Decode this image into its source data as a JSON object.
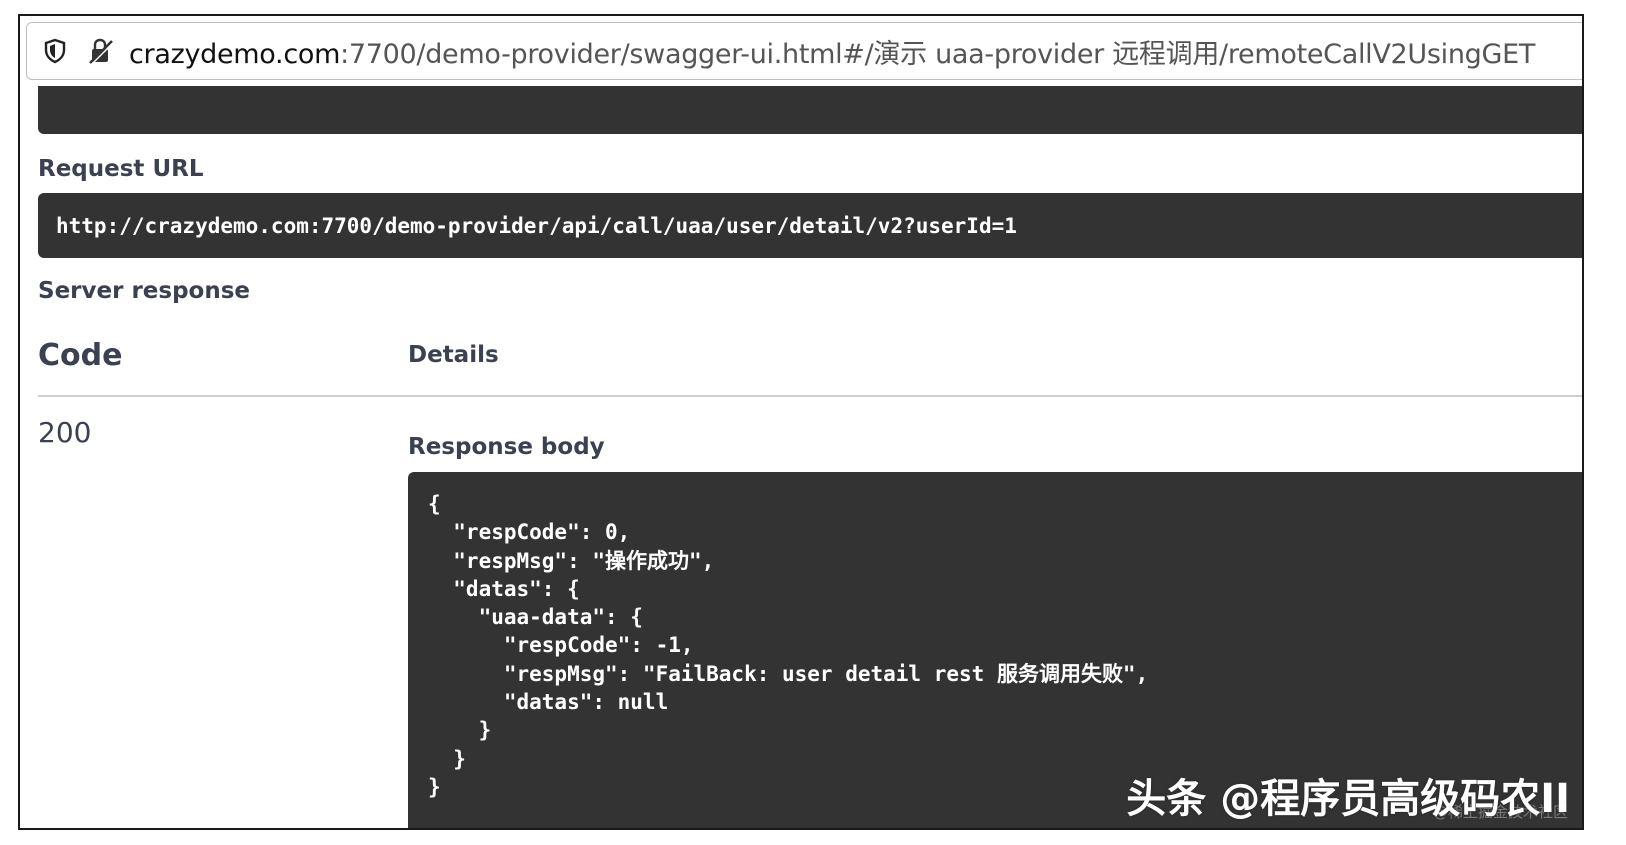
{
  "browser": {
    "url_host": "crazydemo.com",
    "url_rest": ":7700/demo-provider/swagger-ui.html#/演示 uaa-provider 远程调用/remoteCallV2UsingGET",
    "icons": [
      "shield-icon",
      "insecure-lock-icon"
    ]
  },
  "request": {
    "label": "Request URL",
    "url": "http://crazydemo.com:7700/demo-provider/api/call/uaa/user/detail/v2?userId=1"
  },
  "server_response": {
    "label": "Server response",
    "code_header": "Code",
    "details_header": "Details",
    "status_code": "200",
    "response_body_label": "Response body",
    "body_lines": [
      "{",
      "  \"respCode\": 0,",
      "  \"respMsg\": \"操作成功\",",
      "  \"datas\": {",
      "    \"uaa-data\": {",
      "      \"respCode\": -1,",
      "      \"respMsg\": \"FailBack: user detail rest 服务调用失败\",",
      "      \"datas\": null",
      "    }",
      "  }",
      "}"
    ]
  },
  "watermark": {
    "main": "头条 @程序员高级码农II",
    "sub": "@稀土掘金技术社区"
  },
  "colors": {
    "code_bg": "#333333",
    "heading_text": "#3b4151"
  }
}
